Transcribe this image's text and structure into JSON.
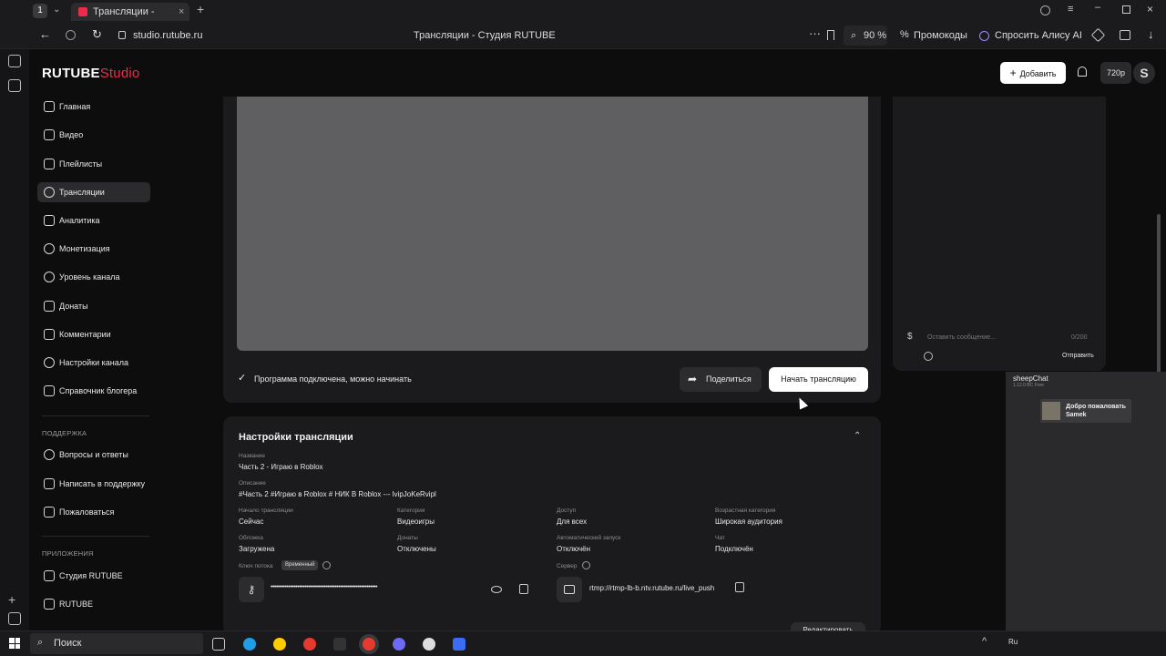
{
  "browser": {
    "tab_title": "Трансляции - Студия R",
    "tab_count": "1",
    "address": "studio.rutube.ru",
    "page_title": "Трансляции - Студия RUTUBE",
    "zoom": "90 %",
    "promo_label": "Промокоды",
    "alice_label": "Спросить Алису AI"
  },
  "app": {
    "logo_main": "RUTUBE",
    "logo_sub": "Studio",
    "add_button": "Добавить",
    "quality": "720p"
  },
  "sidebar": {
    "items": [
      {
        "label": "Главная"
      },
      {
        "label": "Видео"
      },
      {
        "label": "Плейлисты"
      },
      {
        "label": "Трансляции"
      },
      {
        "label": "Аналитика"
      },
      {
        "label": "Монетизация"
      },
      {
        "label": "Уровень канала"
      },
      {
        "label": "Донаты"
      },
      {
        "label": "Комментарии"
      },
      {
        "label": "Настройки канала"
      },
      {
        "label": "Справочник блогера"
      }
    ],
    "support_title": "ПОДДЕРЖКА",
    "support_items": [
      {
        "label": "Вопросы и ответы"
      },
      {
        "label": "Написать в поддержку"
      },
      {
        "label": "Пожаловаться"
      }
    ],
    "apps_title": "ПРИЛОЖЕНИЯ",
    "apps_items": [
      {
        "label": "Студия RUTUBE"
      },
      {
        "label": "RUTUBE"
      }
    ]
  },
  "stream": {
    "status": "Программа подключена, можно начинать",
    "share_button": "Поделиться",
    "start_button": "Начать трансляцию"
  },
  "settings": {
    "title": "Настройки трансляции",
    "name_label": "Название",
    "name_value": "Часть 2 - Играю в Roblox",
    "desc_label": "Описание",
    "desc_value": "#Часть 2 #Играю в Roblox # НИК В Roblox --- lvipJoKeRvipl",
    "start_label": "Начало трансляции",
    "start_value": "Сейчас",
    "category_label": "Категория",
    "category_value": "Видеоигры",
    "access_label": "Доступ",
    "access_value": "Для всех",
    "age_label": "Возрастная категория",
    "age_value": "Широкая аудитория",
    "cover_label": "Обложка",
    "cover_value": "Загружена",
    "donates_label": "Донаты",
    "donates_value": "Отключены",
    "autostart_label": "Автоматический запуск",
    "autostart_value": "Отключён",
    "chat_label": "Чат",
    "chat_value": "Подключён",
    "key_label": "Ключ потока",
    "key_badge": "Временный",
    "key_value": "••••••••••••••••••••••••••••••••••••••••••••••••••••••••••••",
    "server_label": "Сервер",
    "server_value": "rtmp://rtmp-lb-b.ntv.rutube.ru/live_push",
    "edit_button": "Редактировать"
  },
  "chat": {
    "placeholder": "Оставить сообщение...",
    "counter": "0/200",
    "send_button": "Отправить"
  },
  "overlay": {
    "title": "sheepChat",
    "subtitle": "1.12.0 BC Free",
    "welcome_line1": "Добро пожаловать",
    "welcome_line2": "Samek"
  },
  "taskbar": {
    "search": "Поиск",
    "lang": "Ru"
  }
}
